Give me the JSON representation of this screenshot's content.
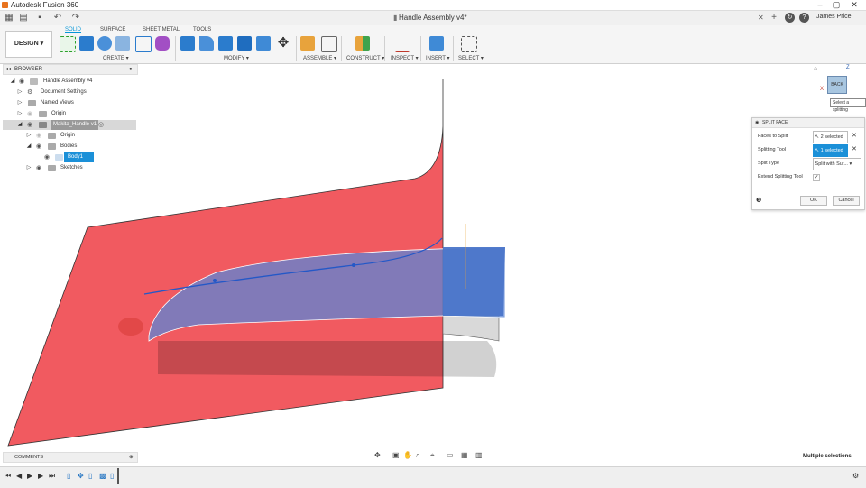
{
  "window": {
    "title": "Autodesk Fusion 360"
  },
  "document": {
    "tab_label": "Handle Assembly v4*"
  },
  "user": {
    "name": "James Price"
  },
  "toolbar": {
    "workspace": "DESIGN",
    "tabs": [
      {
        "label": "SOLID",
        "active": true
      },
      {
        "label": "SURFACE"
      },
      {
        "label": "SHEET METAL"
      },
      {
        "label": "TOOLS"
      }
    ],
    "groups": [
      "CREATE",
      "MODIFY",
      "ASSEMBLE",
      "CONSTRUCT",
      "INSPECT",
      "INSERT",
      "SELECT"
    ]
  },
  "browser": {
    "header": "BROWSER",
    "items": [
      {
        "label": "Handle Assembly v4"
      },
      {
        "label": "Document Settings"
      },
      {
        "label": "Named Views"
      },
      {
        "label": "Origin"
      },
      {
        "label": "Makita_Handle v1"
      },
      {
        "label": "Origin"
      },
      {
        "label": "Bodies"
      },
      {
        "label": "Body1"
      },
      {
        "label": "Sketches"
      }
    ]
  },
  "split_face": {
    "header": "SPLIT FACE",
    "faces_label": "Faces to Split",
    "faces_value": "2 selected",
    "tool_label": "Splitting Tool",
    "tool_value": "1 selected",
    "type_label": "Split Type",
    "type_value": "Split with Sur...",
    "extend_label": "Extend Splitting Tool",
    "ok": "OK",
    "cancel": "Cancel"
  },
  "viewcube": {
    "label": "BACK",
    "axis_x": "X",
    "axis_z": "Z",
    "tooltip": "Select a splitting"
  },
  "comments": {
    "header": "COMMENTS"
  },
  "status": {
    "text": "Multiple selections"
  },
  "colors": {
    "accent": "#0696d7",
    "red_surface": "#f0484f",
    "blue_surface": "#5b86d6"
  }
}
